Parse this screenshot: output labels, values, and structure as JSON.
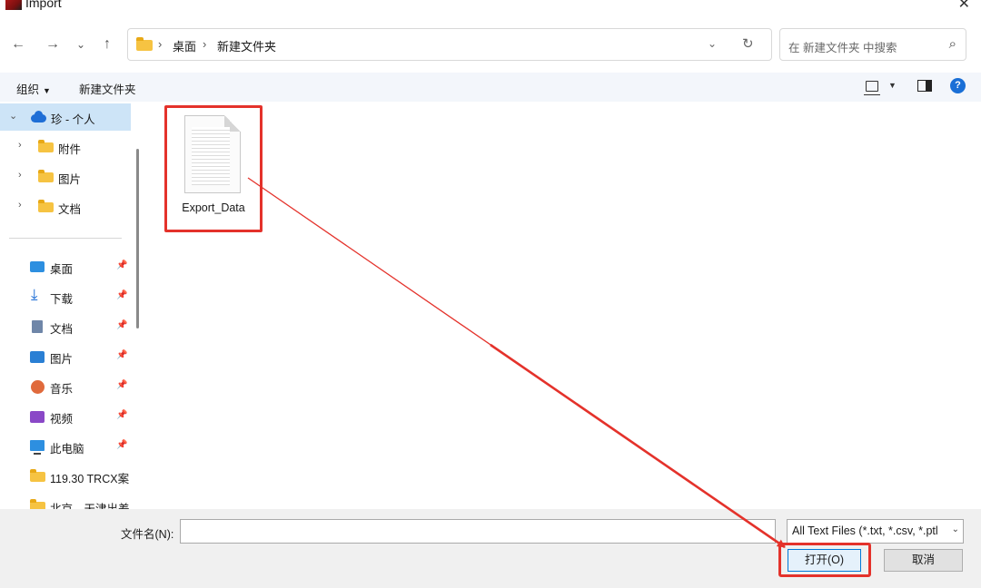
{
  "window": {
    "title": "Import"
  },
  "nav": {
    "breadcrumb": [
      "桌面",
      "新建文件夹"
    ],
    "search_placeholder": "在 新建文件夹 中搜索"
  },
  "toolbar": {
    "organize": "组织",
    "new_folder": "新建文件夹"
  },
  "sidebar": {
    "items": [
      {
        "label": "珍 - 个人"
      },
      {
        "label": "附件"
      },
      {
        "label": "图片"
      },
      {
        "label": "文档"
      },
      {
        "label": "桌面"
      },
      {
        "label": "下载"
      },
      {
        "label": "文档"
      },
      {
        "label": "图片"
      },
      {
        "label": "音乐"
      },
      {
        "label": "视频"
      },
      {
        "label": "此电脑"
      },
      {
        "label": "119.30 TRCX案"
      },
      {
        "label": "北京、天津出差"
      }
    ]
  },
  "files": [
    {
      "name": "Export_Data"
    }
  ],
  "bottom": {
    "filename_label": "文件名(N):",
    "filename_value": "",
    "filetype_selected": "All Text Files (*.txt, *.csv, *.ptl",
    "open_label": "打开(O)",
    "cancel_label": "取消"
  },
  "colors": {
    "highlight": "#e4322b",
    "accent": "#0078d7",
    "selected": "#cde4f7"
  }
}
